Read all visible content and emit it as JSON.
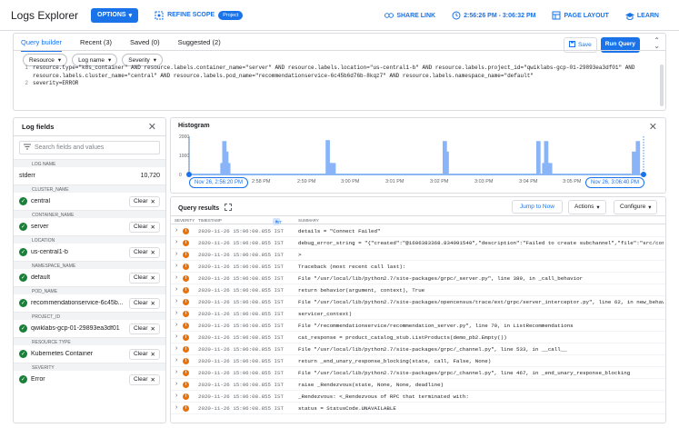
{
  "header": {
    "title": "Logs Explorer",
    "options_label": "OPTIONS",
    "refine_label": "REFINE SCOPE",
    "project_badge": "Project",
    "share_label": "SHARE LINK",
    "time_range": "2:56:26 PM - 3:06:32 PM",
    "page_layout_label": "PAGE LAYOUT",
    "learn_label": "LEARN"
  },
  "query": {
    "tabs": [
      {
        "label": "Query builder"
      },
      {
        "label": "Recent (3)"
      },
      {
        "label": "Saved (0)"
      },
      {
        "label": "Suggested (2)"
      }
    ],
    "save_label": "Save",
    "run_label": "Run Query",
    "filters": [
      {
        "label": "Resource"
      },
      {
        "label": "Log name"
      },
      {
        "label": "Severity"
      }
    ],
    "lines": [
      "resource.type=\"k8s_container\" AND resource.labels.container_name=\"server\" AND resource.labels.location=\"us-central1-b\" AND resource.labels.project_id=\"qwiklabs-gcp-01-29893ea3df01\" AND",
      "resource.labels.cluster_name=\"central\" AND resource.labels.pod_name=\"recommendationservice-6c45b6d76b-8kqz7\" AND resource.labels.namespace_name=\"default\"",
      "severity=ERROR"
    ],
    "line_numbers": [
      "1",
      "",
      "2"
    ]
  },
  "log_fields": {
    "title": "Log fields",
    "search_placeholder": "Search fields and values",
    "log_name_section": "LOG NAME",
    "log_name": "stderr",
    "log_name_count": "10,720",
    "clear_label": "Clear",
    "fields": [
      {
        "section": "CLUSTER_NAME",
        "value": "central"
      },
      {
        "section": "CONTAINER_NAME",
        "value": "server"
      },
      {
        "section": "LOCATION",
        "value": "us-central1-b"
      },
      {
        "section": "NAMESPACE_NAME",
        "value": "default"
      },
      {
        "section": "POD_NAME",
        "value": "recommendationservice-6c45b..."
      },
      {
        "section": "PROJECT_ID",
        "value": "qwiklabs-gcp-01-29893ea3df01"
      },
      {
        "section": "RESOURCE TYPE",
        "value": "Kubernetes Container"
      },
      {
        "section": "SEVERITY",
        "value": "Error"
      }
    ]
  },
  "histogram": {
    "title": "Histogram",
    "start_chip": "Nov 26, 2:56:20 PM",
    "end_chip": "Nov 26, 3:06:40 PM",
    "y_ticks": [
      "2000",
      "1000",
      "0"
    ],
    "x_ticks": [
      "2:58 PM",
      "2:59 PM",
      "3:00 PM",
      "3:01 PM",
      "3:02 PM",
      "3:03 PM",
      "3:04 PM",
      "3:05 PM"
    ]
  },
  "chart_data": {
    "type": "bar",
    "title": "Histogram",
    "ylim": [
      0,
      2000
    ],
    "values": [
      0,
      0,
      0,
      0,
      0,
      0,
      0,
      0,
      0,
      0,
      0,
      0,
      0,
      0,
      0,
      0,
      600,
      1750,
      1200,
      600,
      0,
      0,
      0,
      0,
      0,
      0,
      0,
      0,
      0,
      0,
      0,
      0,
      0,
      0,
      0,
      0,
      0,
      0,
      0,
      0,
      0,
      0,
      0,
      0,
      0,
      0,
      0,
      0,
      0,
      0,
      0,
      0,
      0,
      0,
      0,
      0,
      0,
      0,
      0,
      0,
      0,
      0,
      0,
      0,
      0,
      0,
      0,
      0,
      0,
      0,
      1800,
      600,
      600,
      600,
      0,
      0,
      0,
      0,
      0,
      0,
      0,
      0,
      0,
      0,
      0,
      0,
      0,
      0,
      0,
      0,
      0,
      0,
      0,
      0,
      0,
      0,
      0,
      0,
      0,
      0,
      0,
      0,
      0,
      0,
      0,
      0,
      0,
      0,
      0,
      0,
      0,
      0,
      0,
      0,
      0,
      0,
      0,
      0,
      0,
      0,
      0,
      0,
      0,
      0,
      0,
      0,
      0,
      0,
      0,
      0,
      1750,
      1200,
      0,
      0,
      0,
      0,
      0,
      0,
      0,
      0,
      0,
      0,
      0,
      0,
      0,
      0,
      0,
      0,
      0,
      0,
      0,
      0,
      0,
      0,
      0,
      0,
      0,
      0,
      0,
      0,
      0,
      0,
      0,
      0,
      0,
      0,
      0,
      0,
      0,
      0,
      0,
      0,
      0,
      0,
      0,
      0,
      0,
      0,
      1750,
      0,
      0,
      600,
      1750,
      600,
      600,
      0,
      0,
      0,
      0,
      0,
      0,
      0,
      0,
      0,
      0,
      0,
      0,
      0,
      0,
      0,
      0,
      0,
      0,
      0,
      0,
      0,
      0,
      0,
      0,
      0,
      0,
      0,
      0,
      0,
      0,
      0,
      0,
      0,
      0,
      0,
      0,
      0,
      0,
      0,
      0,
      0,
      0,
      1200,
      600,
      1750,
      0,
      0,
      0
    ]
  },
  "results": {
    "title": "Query results",
    "jump_label": "Jump to Now",
    "actions_label": "Actions",
    "configure_label": "Configure",
    "col_severity": "SEVERITY",
    "col_timestamp": "TIMESTAMP",
    "tz_chip": "IST",
    "col_summary": "SUMMARY",
    "timestamp": "2020-11-26 15:06:08.855 IST",
    "severity_glyph": "!",
    "rows": [
      "details = \"Connect Failed\"",
      "debug_error_string = \"{\"created\":\"@1606383368.834091540\",\"description\":\"Failed to create subchannel\",\"file\":\"src/core...",
      ">",
      "Traceback (most recent call last):",
      "File \"/usr/local/lib/python2.7/site-packages/grpc/_server.py\", line 389, in _call_behavior",
      "return behavior(argument, context), True",
      "File \"/usr/local/lib/python2.7/site-packages/opencensus/trace/ext/grpc/server_interceptor.py\", line 62, in new_behavi...",
      "servicer_context)",
      "File \"/recommendationservice/recommendation_server.py\", line 70, in ListRecommendations",
      "cat_response = product_catalog_stub.ListProducts(demo_pb2.Empty())",
      "File \"/usr/local/lib/python2.7/site-packages/grpc/_channel.py\", line 533, in __call__",
      "return _end_unary_response_blocking(state, call, False, None)",
      "File \"/usr/local/lib/python2.7/site-packages/grpc/_channel.py\", line 467, in _end_unary_response_blocking",
      "raise _Rendezvous(state, None, None, deadline)",
      "_Rendezvous: <_Rendezvous of RPC that terminated with:",
      "status = StatusCode.UNAVAILABLE"
    ]
  }
}
